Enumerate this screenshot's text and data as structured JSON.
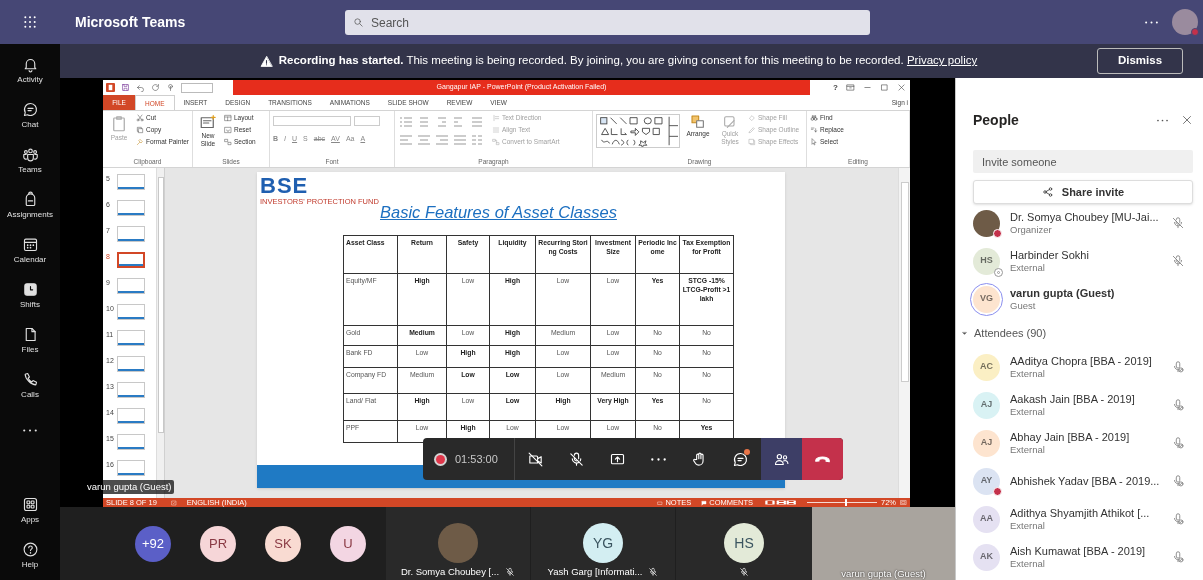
{
  "app_bar": {
    "title": "Microsoft Teams",
    "search": {
      "placeholder": "Search"
    },
    "user": {
      "busy": true
    }
  },
  "rail": {
    "items": [
      {
        "kind": "page",
        "label": "Activity"
      },
      {
        "kind": "page",
        "label": "Chat"
      },
      {
        "kind": "page",
        "label": "Teams"
      },
      {
        "kind": "page",
        "label": "Assignments"
      },
      {
        "kind": "page",
        "label": "Calendar"
      },
      {
        "kind": "page",
        "label": "Shifts"
      },
      {
        "kind": "page",
        "label": "Files"
      },
      {
        "kind": "page",
        "label": "Calls"
      },
      {
        "kind": "more"
      }
    ],
    "footer": [
      {
        "label": "Apps"
      },
      {
        "label": "Help"
      }
    ]
  },
  "banner": {
    "message": "**Recording has started.** This meeting is being recorded. By joining, you are giving consent for this meeting to be recorded.",
    "link": "Privacy policy",
    "button": "Dismiss"
  },
  "presentation": {
    "window_title": "Gangapur IAP -  PowerPoint (Product Activation Failed)",
    "help": "?",
    "tabs": [
      {
        "label": "FILE",
        "kind": "file",
        "selected": false
      },
      {
        "label": "HOME",
        "kind": "tab",
        "selected": true
      },
      {
        "label": "INSERT",
        "kind": "tab",
        "selected": false
      },
      {
        "label": "DESIGN",
        "kind": "tab",
        "selected": false
      },
      {
        "label": "TRANSITIONS",
        "kind": "tab",
        "selected": false
      },
      {
        "label": "ANIMATIONS",
        "kind": "tab",
        "selected": false
      },
      {
        "label": "SLIDE SHOW",
        "kind": "tab",
        "selected": false
      },
      {
        "label": "REVIEW",
        "kind": "tab",
        "selected": false
      },
      {
        "label": "VIEW",
        "kind": "tab",
        "selected": false
      }
    ],
    "sign_in": "Sign i",
    "ribbon": [
      {
        "name": "Clipboard",
        "kind": "clipboard",
        "items": [
          "Paste",
          "Cut",
          "Copy",
          "Format Painter"
        ]
      },
      {
        "name": "Slides",
        "kind": "slides",
        "items": [
          "New Slide",
          "Layout",
          "Reset",
          "Section"
        ]
      },
      {
        "name": "Font",
        "kind": "font",
        "items": [
          "B",
          "I",
          "U",
          "S",
          "abc",
          "AV",
          "Aa",
          "A"
        ]
      },
      {
        "name": "Paragraph",
        "kind": "paragraph",
        "items": [
          "Text Direction",
          "Align Text",
          "Convert to SmartArt"
        ]
      },
      {
        "name": "Drawing",
        "kind": "drawing",
        "items": [
          "Arrange",
          "Quick Styles",
          "Shape Fill",
          "Shape Outline",
          "Shape Effects"
        ]
      },
      {
        "name": "Editing",
        "kind": "editing",
        "items": [
          "Find",
          "Replace",
          "Select"
        ]
      }
    ],
    "thumbnails": [
      {
        "number": "5",
        "selected": false
      },
      {
        "number": "6",
        "selected": false
      },
      {
        "number": "7",
        "selected": false
      },
      {
        "number": "8",
        "selected": true
      },
      {
        "number": "9",
        "selected": false
      },
      {
        "number": "10",
        "selected": false
      },
      {
        "number": "11",
        "selected": false
      },
      {
        "number": "12",
        "selected": false
      },
      {
        "number": "13",
        "selected": false
      },
      {
        "number": "14",
        "selected": false
      },
      {
        "number": "15",
        "selected": false
      },
      {
        "number": "16",
        "selected": false
      }
    ],
    "slide": {
      "logo": "BSE",
      "logo_tagline": "INVESTORS' PROTECTION FUND",
      "title": "Basic Features of Asset Classes",
      "table": {
        "columns": [
          "Asset Class",
          "Return",
          "Safety",
          "Liquidity",
          "Recurring Storing Costs",
          "Investment Size",
          "Periodic Income",
          "Tax Exemption for Profit"
        ],
        "rows": [
          [
            {
              "text": "Equity/MF",
              "bold": false
            },
            {
              "text": "High",
              "bold": true
            },
            {
              "text": "Low",
              "bold": false
            },
            {
              "text": "High",
              "bold": true
            },
            {
              "text": "Low",
              "bold": false
            },
            {
              "text": "Low",
              "bold": false
            },
            {
              "text": "Yes",
              "bold": true
            },
            {
              "text": "STCG -15% LTCG-Profit >1 lakh",
              "bold": true
            }
          ],
          [
            {
              "text": "Gold",
              "bold": false
            },
            {
              "text": "Medium",
              "bold": true
            },
            {
              "text": "Low",
              "bold": false
            },
            {
              "text": "High",
              "bold": true
            },
            {
              "text": "Medium",
              "bold": false
            },
            {
              "text": "Low",
              "bold": false
            },
            {
              "text": "No",
              "bold": false
            },
            {
              "text": "No",
              "bold": false
            }
          ],
          [
            {
              "text": "Bank FD",
              "bold": false
            },
            {
              "text": "Low",
              "bold": false
            },
            {
              "text": "High",
              "bold": true
            },
            {
              "text": "High",
              "bold": true
            },
            {
              "text": "Low",
              "bold": false
            },
            {
              "text": "Low",
              "bold": false
            },
            {
              "text": "No",
              "bold": false
            },
            {
              "text": "No",
              "bold": false
            }
          ],
          [
            {
              "text": "Company FD",
              "bold": false
            },
            {
              "text": "Medium",
              "bold": false
            },
            {
              "text": "Low",
              "bold": true
            },
            {
              "text": "Low",
              "bold": true
            },
            {
              "text": "Low",
              "bold": false
            },
            {
              "text": "Medium",
              "bold": false
            },
            {
              "text": "No",
              "bold": false
            },
            {
              "text": "No",
              "bold": false
            }
          ],
          [
            {
              "text": "Land/ Flat",
              "bold": false
            },
            {
              "text": "High",
              "bold": true
            },
            {
              "text": "Low",
              "bold": false
            },
            {
              "text": "Low",
              "bold": true
            },
            {
              "text": "High",
              "bold": true
            },
            {
              "text": "Very High",
              "bold": true
            },
            {
              "text": "Yes",
              "bold": true
            },
            {
              "text": "No",
              "bold": false
            }
          ],
          [
            {
              "text": "PPF",
              "bold": false
            },
            {
              "text": "Low",
              "bold": false
            },
            {
              "text": "High",
              "bold": true
            },
            {
              "text": "Low",
              "bold": false
            },
            {
              "text": "Low",
              "bold": false
            },
            {
              "text": "Low",
              "bold": false
            },
            {
              "text": "No",
              "bold": false
            },
            {
              "text": "Yes",
              "bold": true
            }
          ]
        ]
      }
    },
    "status_bar": {
      "slide": "SLIDE 8 OF 19",
      "language": "ENGLISH (INDIA)",
      "notes": "NOTES",
      "comments": "COMMENTS",
      "zoom": "72%",
      "zoom_slider": {
        "level": 0.55
      }
    }
  },
  "stage_caption": "varun gupta (Guest)",
  "call_controls": {
    "recording": true,
    "timer": "01:53:00",
    "buttons": [
      {
        "selected": false,
        "badge": false
      },
      {
        "selected": false,
        "badge": false
      },
      {
        "selected": false,
        "badge": false
      },
      {
        "selected": false,
        "badge": false
      },
      {
        "selected": false,
        "badge": false
      },
      {
        "selected": false,
        "badge": true
      },
      {
        "selected": true,
        "badge": false
      },
      {
        "selected": false,
        "badge": false
      }
    ]
  },
  "gallery": {
    "overflow": [
      {
        "kind": "count",
        "initials": "+92",
        "color": "#5b5fc7"
      },
      {
        "kind": "person",
        "initials": "PR",
        "color": "#f6d6d8"
      },
      {
        "kind": "person",
        "initials": "SK",
        "color": "#f9dbd2"
      },
      {
        "kind": "person",
        "initials": "U",
        "color": "#f3d6e3"
      }
    ],
    "tiles": [
      {
        "kind": "photo",
        "name": "Dr. Somya Choubey [...",
        "muted": true
      },
      {
        "kind": "initials",
        "initials": "YG",
        "color": "#d3eef2",
        "name": "Yash Garg [Informati...",
        "muted": true
      },
      {
        "kind": "initials",
        "initials": "HS",
        "color": "#e3ead8",
        "muted": true
      },
      {
        "kind": "video",
        "name": "varun gupta (Guest)"
      }
    ]
  },
  "people": {
    "title": "People",
    "invite": {
      "placeholder": "Invite someone"
    },
    "share_button": "Share invite",
    "presenters": [
      {
        "name": "Dr. Somya Choubey [MU-Jai...",
        "role": "Organizer",
        "busy": true,
        "offline": false,
        "muted": true,
        "speaking": false
      },
      {
        "name": "Harbinder Sokhi",
        "role": "External",
        "initials": "HS",
        "color": "#e3ead8",
        "busy": false,
        "offline": true,
        "muted": true,
        "speaking": false
      },
      {
        "name": "varun gupta (Guest)",
        "role": "Guest",
        "initials": "VG",
        "color": "#fde4cf",
        "busy": false,
        "offline": false,
        "muted": false,
        "speaking": true
      }
    ],
    "attendees": {
      "label": "Attendees (90)",
      "expanded": true,
      "items": [
        {
          "name": "AAditya Chopra [BBA - 2019]",
          "role": "External",
          "initials": "AC",
          "color": "#fbefc4",
          "busy": false,
          "mic_disabled": true
        },
        {
          "name": "Aakash Jain [BBA - 2019]",
          "role": "External",
          "initials": "AJ",
          "color": "#d9f2f4",
          "busy": false,
          "mic_disabled": true
        },
        {
          "name": "Abhay Jain [BBA - 2019]",
          "role": "External",
          "initials": "AJ",
          "color": "#fde4cf",
          "busy": false,
          "mic_disabled": true
        },
        {
          "name": "Abhishek Yadav [BBA - 2019...",
          "initials": "AY",
          "color": "#dbe3f2",
          "busy": true,
          "mic_disabled": true
        },
        {
          "name": "Adithya Shyamjith Athikot [...",
          "role": "External",
          "initials": "AA",
          "color": "#e5e1f2",
          "busy": false,
          "mic_disabled": true
        },
        {
          "name": "Aish Kumawat [BBA - 2019]",
          "role": "External",
          "initials": "AK",
          "color": "#e5e1f2",
          "busy": false,
          "mic_disabled": true
        }
      ]
    }
  }
}
